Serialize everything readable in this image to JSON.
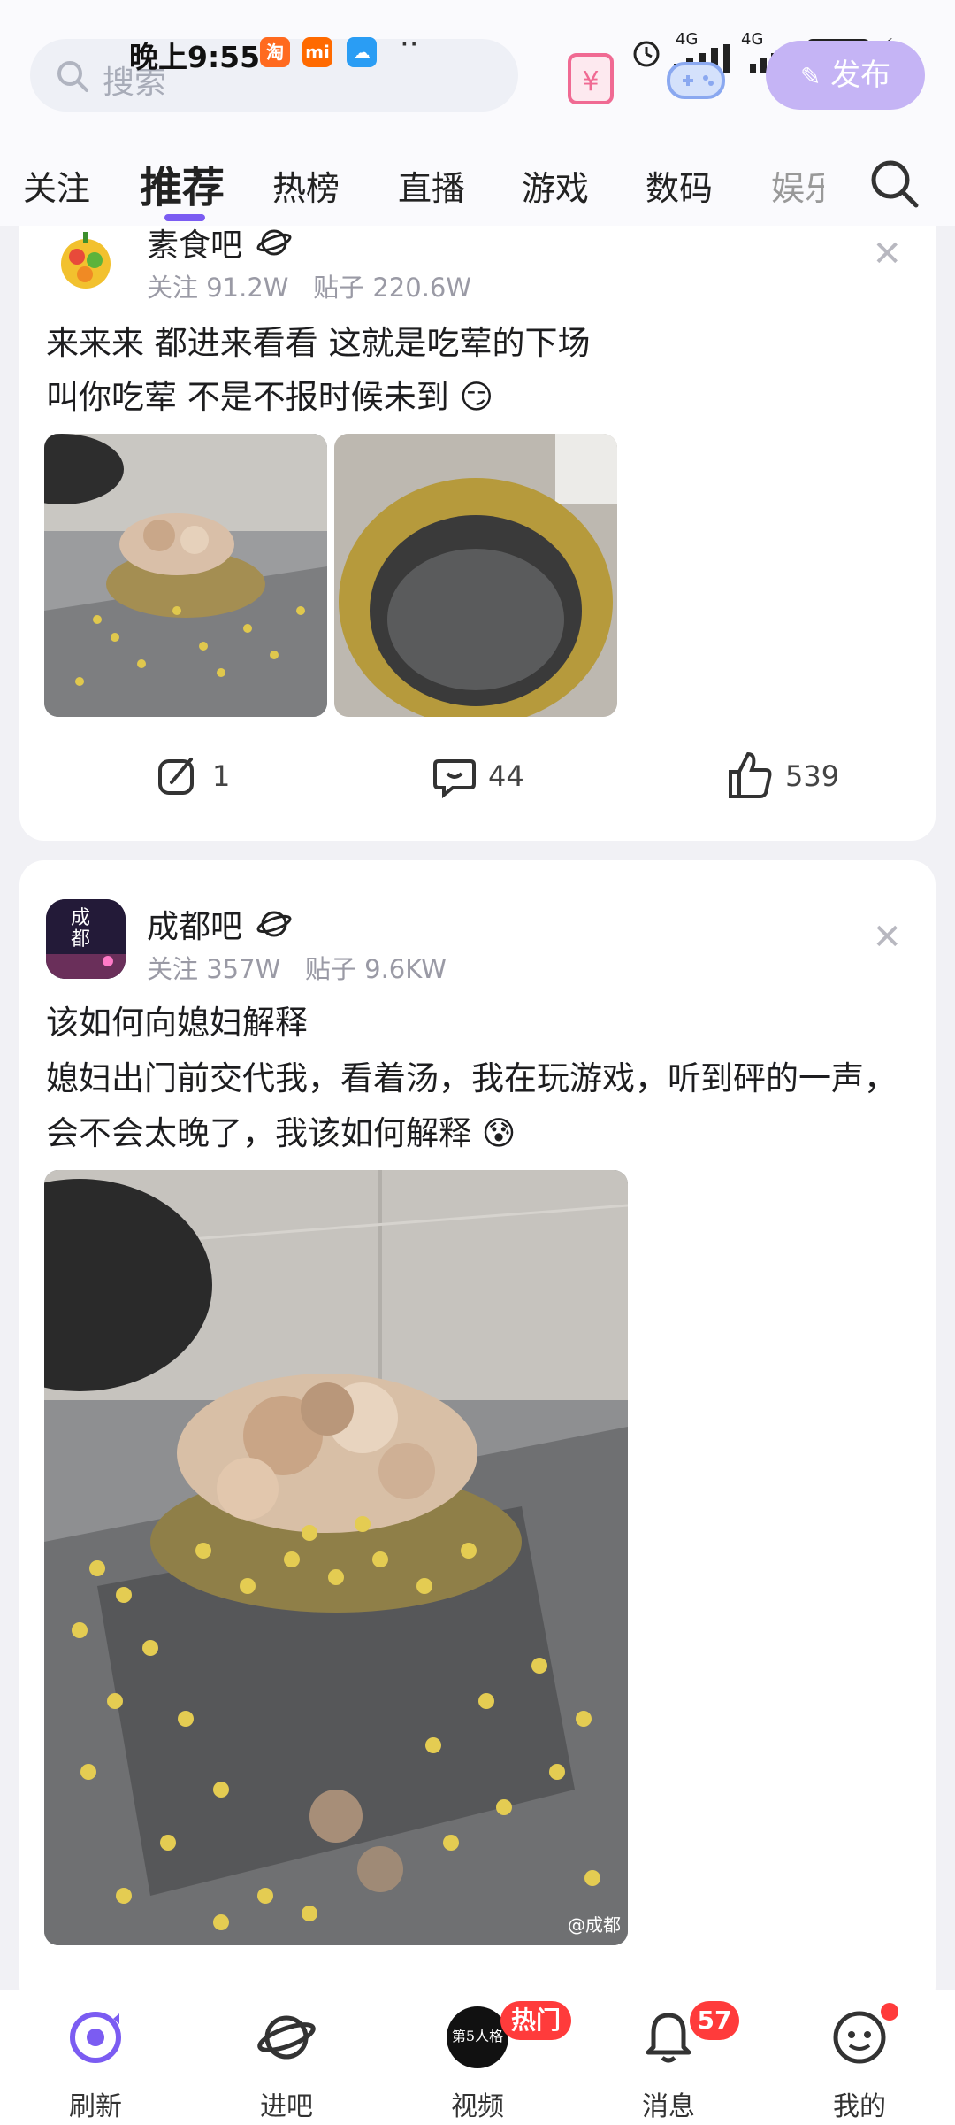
{
  "status_bar": {
    "time": "晚上9:55",
    "battery": "97",
    "network1": "4G",
    "network2": "4G"
  },
  "search": {
    "placeholder": "搜索"
  },
  "publish_label": "发布",
  "tabs": [
    {
      "label": "关注"
    },
    {
      "label": "推荐"
    },
    {
      "label": "热榜"
    },
    {
      "label": "直播"
    },
    {
      "label": "游戏"
    },
    {
      "label": "数码"
    },
    {
      "label": "娱乐"
    }
  ],
  "posts": [
    {
      "bar_name": "素食吧",
      "meta": "关注 91.2W   贴子 220.6W",
      "title": "来来来 都进来看看 这就是吃荤的下场",
      "body": "叫你吃荤 不是不报时候未到",
      "emoji": "😏",
      "shares": "1",
      "comments": "44",
      "likes": "539"
    },
    {
      "bar_name": "成都吧",
      "meta": "关注 357W   贴子 9.6KW",
      "title": "该如何向媳妇解释",
      "body": "媳妇出门前交代我，看着汤，我在玩游戏，听到砰的一声，会不会太晚了，我该如何解释",
      "emoji": "😰",
      "avatar_text": "成都",
      "watermark": "@成都"
    }
  ],
  "bottom_nav": [
    {
      "label": "刷新"
    },
    {
      "label": "进吧"
    },
    {
      "label": "视频",
      "badge": "热门",
      "avatar_text": "第5人格"
    },
    {
      "label": "消息",
      "badge": "57"
    },
    {
      "label": "我的"
    }
  ],
  "colors": {
    "accent": "#7b5cf2",
    "publish": "#c5b4f5",
    "badge": "#ff3b3b"
  }
}
